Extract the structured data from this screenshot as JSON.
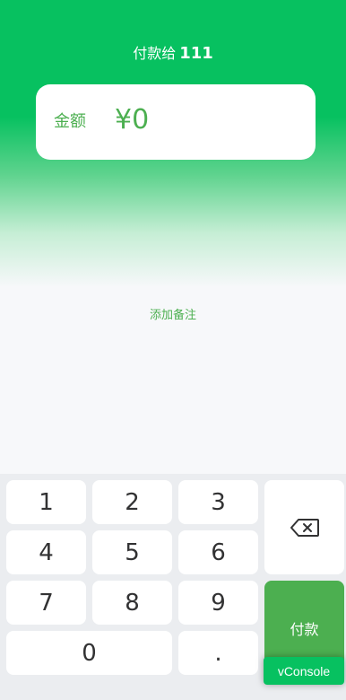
{
  "header": {
    "title_prefix": "付款给",
    "payee": "111"
  },
  "amount": {
    "label": "金额",
    "currency_symbol": "¥",
    "value": "0"
  },
  "remark": {
    "link_label": "添加备注"
  },
  "keypad": {
    "digits": [
      "1",
      "2",
      "3",
      "4",
      "5",
      "6",
      "7",
      "8",
      "9",
      "0"
    ],
    "decimal": ".",
    "delete_icon": "backspace-icon",
    "pay_label": "付款"
  },
  "vconsole": {
    "label": "vConsole"
  },
  "colors": {
    "brand": "#07c160",
    "accent": "#4caf50",
    "keypad_bg": "#ebedf0",
    "page_bg": "#f7f8fa"
  }
}
